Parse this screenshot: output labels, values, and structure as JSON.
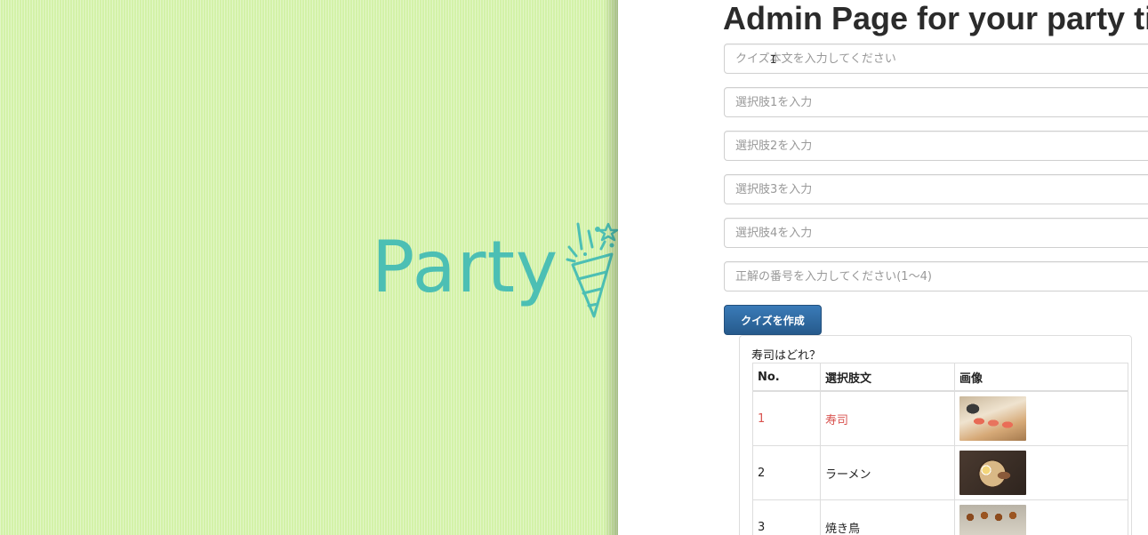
{
  "brand": {
    "logo_text": "Party",
    "logo_color": "#4cbfb4",
    "panel_bg": "#d3f2a8"
  },
  "header": {
    "title": "Admin Page for your party tit"
  },
  "form": {
    "question_placeholder": "クイズ本文を入力してください",
    "choice1_placeholder": "選択肢1を入力",
    "choice2_placeholder": "選択肢2を入力",
    "choice3_placeholder": "選択肢3を入力",
    "choice4_placeholder": "選択肢4を入力",
    "answer_placeholder": "正解の番号を入力してください(1～4)",
    "submit_label": "クイズを作成",
    "submit_color": "#2d6aa3"
  },
  "quiz": {
    "question": "寿司はどれ？",
    "columns": [
      "No.",
      "選択肢文",
      "画像"
    ],
    "correct_color": "#d9534f",
    "rows": [
      {
        "no": "1",
        "text": "寿司",
        "image": "sushi-photo",
        "correct": true
      },
      {
        "no": "2",
        "text": "ラーメン",
        "image": "ramen-photo",
        "correct": false
      },
      {
        "no": "3",
        "text": "焼き鳥",
        "image": "yakitori-photo",
        "correct": false
      }
    ]
  },
  "cursor": {
    "icon": "text-cursor-icon",
    "glyph": "I"
  }
}
